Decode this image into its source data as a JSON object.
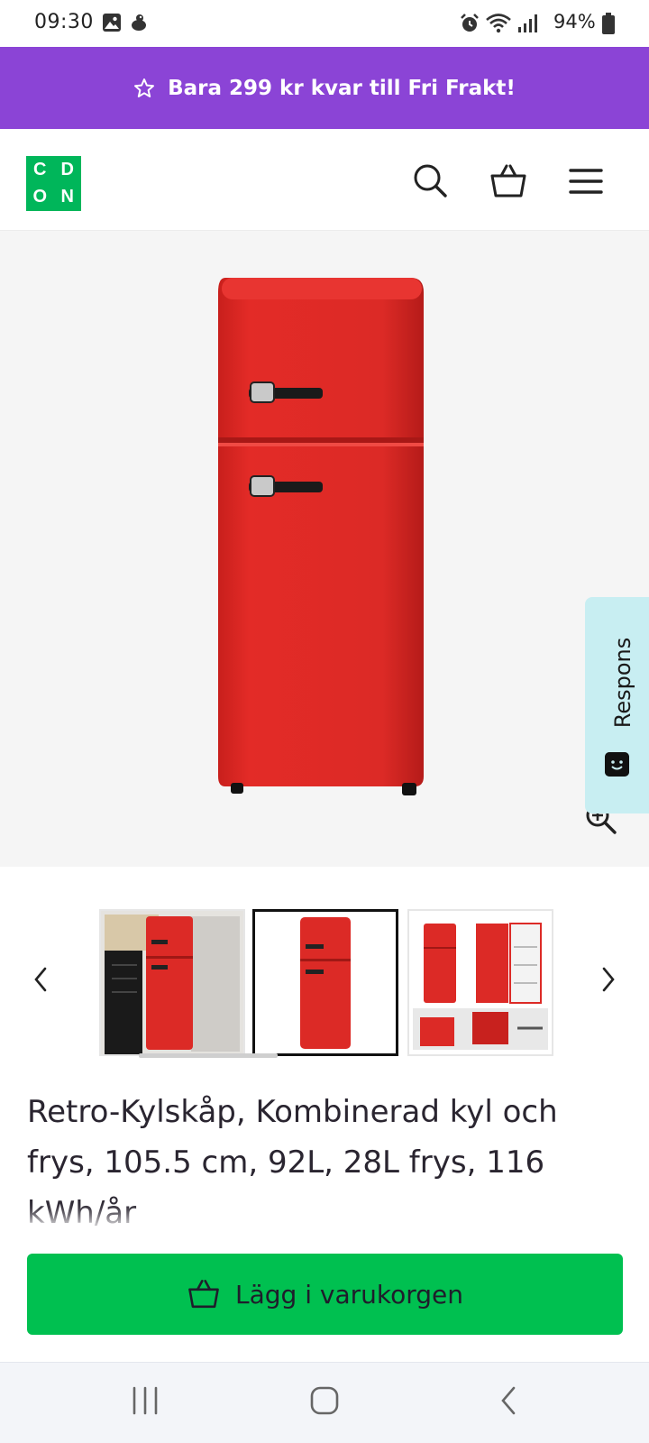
{
  "status_bar": {
    "time": "09:30",
    "battery": "94%",
    "icons": [
      "gallery-icon",
      "notification-icon",
      "alarm-icon",
      "wifi-icon",
      "signal-icon",
      "battery-icon"
    ]
  },
  "promo": {
    "icon": "star-outline-icon",
    "text": "Bara 299 kr kvar till Fri Frakt!",
    "background": "#8b44d6"
  },
  "header": {
    "logo_letters": [
      "C",
      "D",
      "O",
      "N"
    ],
    "logo_color": "#00b65a",
    "icons": [
      "search-icon",
      "basket-icon",
      "menu-icon"
    ]
  },
  "product": {
    "image_subject": "red retro fridge-freezer",
    "title": "Retro-Kylskåp, Kombinerad kyl och frys, 105.5 cm, 92L, 28L frys, 116 kWh/år",
    "selected_thumbnail": 2,
    "thumbnail_count": 3
  },
  "feedback": {
    "label": "Respons",
    "background": "#c8eef2"
  },
  "cart": {
    "button_label": "Lägg i varukorgen",
    "button_color": "#00c050"
  },
  "system_nav": {
    "icons": [
      "recent-apps-icon",
      "home-icon",
      "back-icon"
    ]
  }
}
